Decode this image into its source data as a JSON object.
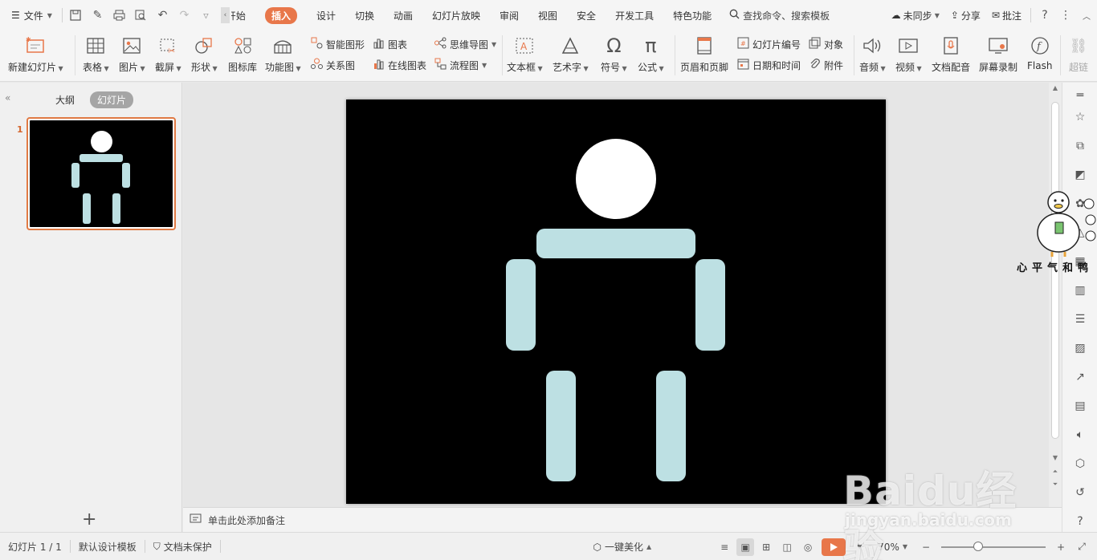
{
  "menubar": {
    "file_label": "文件",
    "tabs": [
      {
        "label": "开始",
        "display": "开始",
        "active": false
      },
      {
        "label": "插入",
        "active": true
      },
      {
        "label": "设计",
        "active": false
      },
      {
        "label": "切换",
        "active": false
      },
      {
        "label": "动画",
        "active": false
      },
      {
        "label": "幻灯片放映",
        "active": false
      },
      {
        "label": "审阅",
        "active": false
      },
      {
        "label": "视图",
        "active": false
      },
      {
        "label": "安全",
        "active": false
      },
      {
        "label": "开发工具",
        "active": false
      },
      {
        "label": "特色功能",
        "active": false
      }
    ],
    "search_label": "查找命令、搜索模板",
    "sync_label": "未同步",
    "share_label": "分享",
    "comment_label": "批注",
    "help_icon": "?"
  },
  "ribbon": {
    "new_slide": "新建幻灯片",
    "table": "表格",
    "picture": "图片",
    "screenshot": "截屏",
    "shapes": "形状",
    "icon_lib": "图标库",
    "function_chart": "功能图",
    "smart_art": "智能图形",
    "relation_chart": "关系图",
    "chart": "图表",
    "online_chart": "在线图表",
    "mind_map": "思维导图",
    "flow_chart": "流程图",
    "text_box": "文本框",
    "art_text": "艺术字",
    "symbol": "符号",
    "formula": "公式",
    "header_footer": "页眉和页脚",
    "slide_number": "幻灯片编号",
    "date_time": "日期和时间",
    "object": "对象",
    "attachment": "附件",
    "audio": "音频",
    "video": "视频",
    "doc_dub": "文档配音",
    "screen_record": "屏幕录制",
    "flash": "Flash",
    "hyperlink": "超链"
  },
  "leftpanel": {
    "outline_tab": "大纲",
    "slides_tab": "幻灯片",
    "slide_number": "1"
  },
  "notes": {
    "placeholder": "单击此处添加备注"
  },
  "statusbar": {
    "slide_count": "幻灯片 1 / 1",
    "template": "默认设计模板",
    "protection": "文档未保护",
    "beautify": "一键美化",
    "zoom": "70%"
  },
  "watermark": {
    "brand": "Baidu经验",
    "url": "jingyan.baidu.com"
  },
  "sticker": {
    "text": "心平气和鸭"
  },
  "colors": {
    "accent": "#e8774a",
    "slide_bg": "#000000",
    "shape_fill": "#bde0e3",
    "head_fill": "#ffffff"
  }
}
